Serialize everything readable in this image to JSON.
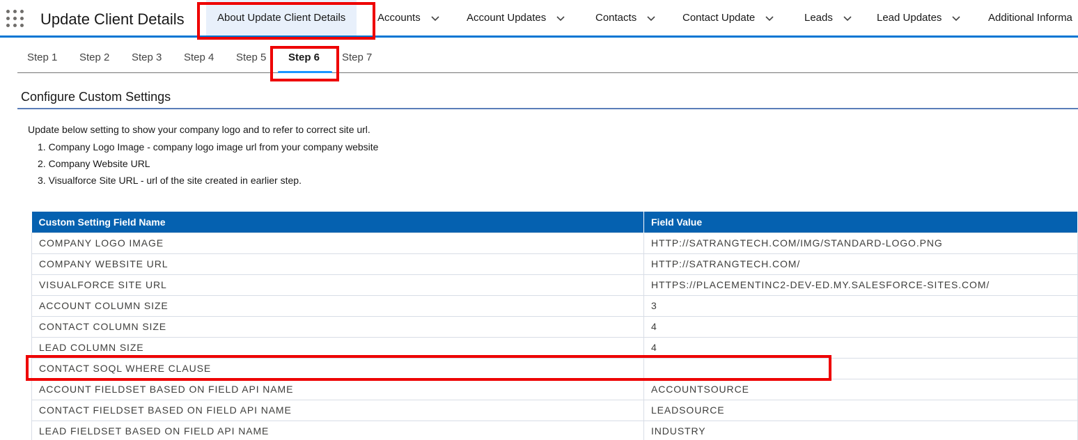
{
  "app": {
    "title": "Update Client Details"
  },
  "nav": {
    "items": [
      {
        "label": "About Update Client Details",
        "has_menu": false,
        "active": true
      },
      {
        "label": "Accounts",
        "has_menu": true
      },
      {
        "label": "Account Updates",
        "has_menu": true
      },
      {
        "label": "Contacts",
        "has_menu": true
      },
      {
        "label": "Contact Update",
        "has_menu": true
      },
      {
        "label": "Leads",
        "has_menu": true
      },
      {
        "label": "Lead Updates",
        "has_menu": true
      },
      {
        "label": "Additional Informa",
        "has_menu": false
      }
    ]
  },
  "steps": {
    "tabs": [
      "Step 1",
      "Step 2",
      "Step 3",
      "Step 4",
      "Step 5",
      "Step 6",
      "Step 7"
    ],
    "active": "Step 6"
  },
  "section": {
    "title": "Configure Custom Settings",
    "intro": "Update below setting to show your company logo and to refer to correct site url.",
    "list": [
      "1. Company Logo Image - company logo image url from your company website",
      "2. Company Website URL",
      "3. Visualforce Site URL - url of the site created in earlier step."
    ]
  },
  "table": {
    "headers": [
      "Custom Setting Field Name",
      "Field Value"
    ],
    "rows": [
      [
        "COMPANY LOGO IMAGE",
        "HTTP://SATRANGTECH.COM/IMG/STANDARD-LOGO.PNG"
      ],
      [
        "COMPANY WEBSITE URL",
        "HTTP://SATRANGTECH.COM/"
      ],
      [
        "VISUALFORCE SITE URL",
        "HTTPS://PLACEMENTINC2-DEV-ED.MY.SALESFORCE-SITES.COM/"
      ],
      [
        "ACCOUNT COLUMN SIZE",
        "3"
      ],
      [
        "CONTACT COLUMN SIZE",
        "4"
      ],
      [
        "LEAD COLUMN SIZE",
        "4"
      ],
      [
        "CONTACT SOQL WHERE CLAUSE",
        ""
      ],
      [
        "ACCOUNT FIELDSET BASED ON FIELD API NAME",
        "ACCOUNTSOURCE"
      ],
      [
        "CONTACT FIELDSET BASED ON FIELD API NAME",
        "LEADSOURCE"
      ],
      [
        "LEAD FIELDSET BASED ON FIELD API NAME",
        "INDUSTRY"
      ]
    ]
  },
  "colors": {
    "brand_blue": "#0176d3",
    "header_blue": "#0561b0",
    "highlight_red": "#ee0000",
    "tab_underline": "#1b96ff"
  },
  "icons": {
    "app_launcher": "waffle-grid-icon",
    "menu": "chevron-down-icon"
  }
}
